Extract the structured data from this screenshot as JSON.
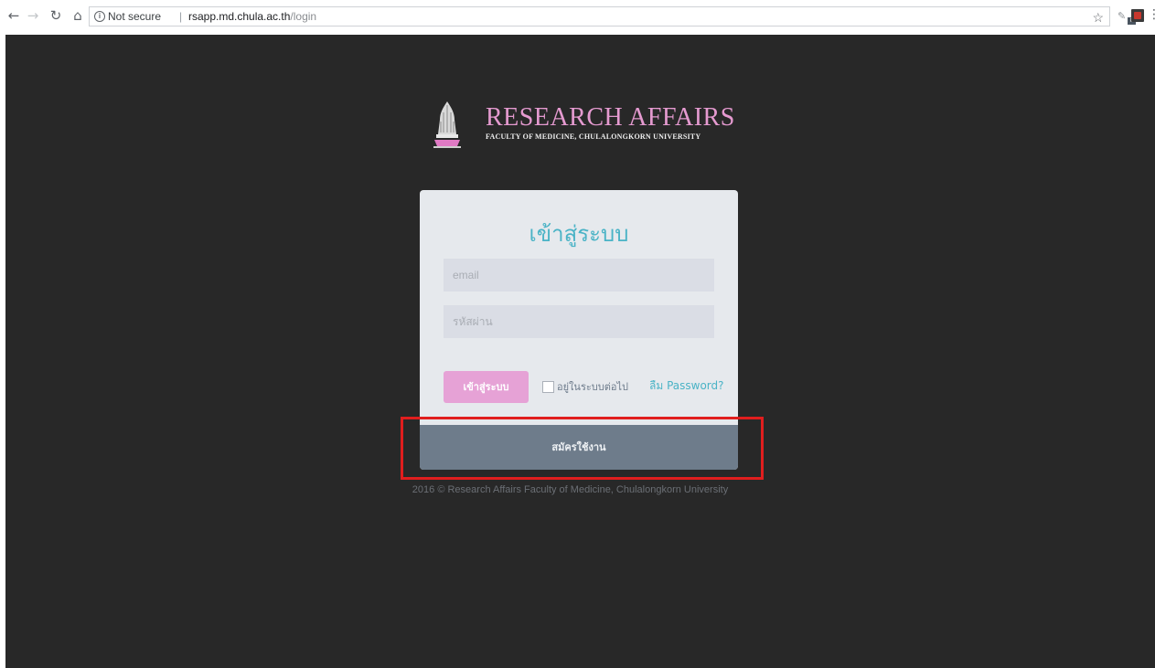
{
  "browser": {
    "security_label": "Not secure",
    "url_host": "rsapp.md.chula.ac.th",
    "url_path": "/login",
    "separator": "|"
  },
  "brand": {
    "title": "RESEARCH AFFAIRS",
    "subtitle": "FACULTY OF MEDICINE, CHULALONGKORN UNIVERSITY",
    "accent_color": "#e59ad0"
  },
  "login_form": {
    "title": "เข้าสู่ระบบ",
    "email_placeholder": "email",
    "password_placeholder": "รหัสผ่าน",
    "login_button": "เข้าสู่ระบบ",
    "remember_label": "อยู่ในระบบต่อไป",
    "forgot_link": "ลืม Password?",
    "register_button": "สมัครใช้งาน"
  },
  "footer": {
    "copyright": "2016 © Research Affairs Faculty of Medicine, Chulalongkorn University"
  },
  "icons": {
    "back": "back-arrow-icon",
    "forward": "forward-arrow-icon",
    "reload": "reload-icon",
    "home": "home-icon",
    "info": "info-icon",
    "bookmark": "star-icon",
    "menu": "menu-dots-icon"
  },
  "colors": {
    "page_background": "#282828",
    "card_background": "#e6e9ed",
    "title_color": "#4ab3c6",
    "login_button": "#e6a2d6",
    "register_bar": "#6e7c8b",
    "highlight": "#e01e1e"
  }
}
